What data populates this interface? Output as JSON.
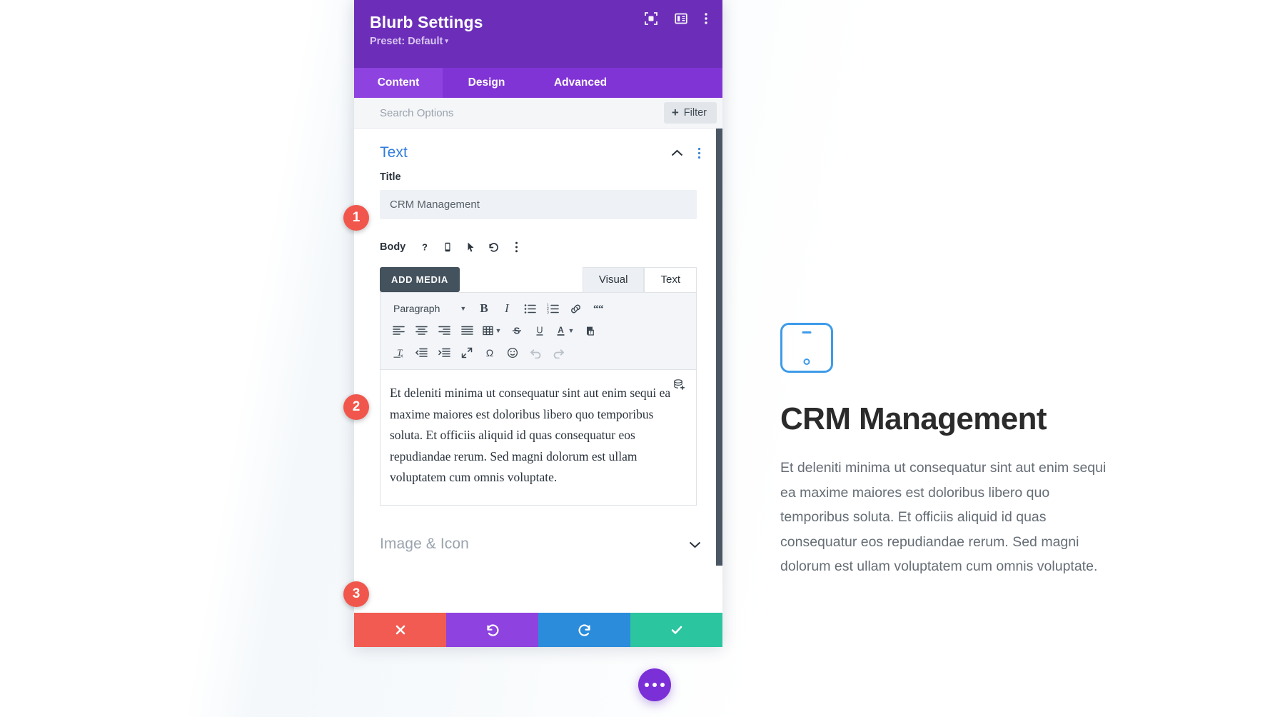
{
  "panel": {
    "title": "Blurb Settings",
    "preset": "Preset: Default",
    "preset_caret": "▾",
    "header_icons": [
      {
        "name": "expand-icon"
      },
      {
        "name": "layout-columns-icon"
      },
      {
        "name": "kebab-menu-icon"
      }
    ],
    "tabs": [
      {
        "label": "Content",
        "active": true
      },
      {
        "label": "Design",
        "active": false
      },
      {
        "label": "Advanced",
        "active": false
      }
    ],
    "search": {
      "placeholder": "Search Options",
      "value": ""
    },
    "filter": {
      "label": "Filter",
      "plus": "+"
    }
  },
  "sections": {
    "text": {
      "title": "Text",
      "collapse_icon": "chevron-up-icon",
      "menu_icon": "kebab-menu-icon"
    },
    "image_icon": {
      "title": "Image & Icon",
      "expand_icon": "chevron-down-icon"
    }
  },
  "fields": {
    "title": {
      "label": "Title",
      "value": "CRM Management"
    },
    "body": {
      "label": "Body",
      "icons": [
        "help-icon",
        "mobile-icon",
        "cursor-icon",
        "reset-icon",
        "kebab-menu-icon"
      ]
    }
  },
  "editor": {
    "add_media_label": "ADD MEDIA",
    "mode_tabs": [
      {
        "label": "Visual",
        "active": true
      },
      {
        "label": "Text",
        "active": false
      }
    ],
    "format_select": "Paragraph",
    "toolbar_row1": [
      "bold-icon",
      "italic-icon",
      "bulleted-list-icon",
      "numbered-list-icon",
      "link-icon",
      "blockquote-icon"
    ],
    "toolbar_row2": [
      "align-left-icon",
      "align-center-icon",
      "align-right-icon",
      "align-justify-icon",
      "table-icon",
      "strikethrough-icon",
      "underline-icon",
      "text-color-icon",
      "paste-as-text-icon"
    ],
    "toolbar_row3": [
      "clear-formatting-icon",
      "outdent-icon",
      "indent-icon",
      "fullscreen-icon",
      "special-character-icon",
      "emoji-icon",
      "undo-icon",
      "redo-icon"
    ],
    "dynamic_content_icon": "add-dynamic-content-icon",
    "content": "Et deleniti minima ut consequatur sint aut enim sequi ea maxime maiores est doloribus libero quo temporibus soluta. Et officiis aliquid id quas consequatur eos repudiandae rerum. Sed magni dolorum est ullam voluptatem cum omnis voluptate."
  },
  "bottom_bar": [
    {
      "name": "cancel-button",
      "icon": "close-icon",
      "color": "#F15B51"
    },
    {
      "name": "undo-button",
      "icon": "undo-icon",
      "color": "#8E42E0"
    },
    {
      "name": "redo-button",
      "icon": "redo-icon",
      "color": "#2B8CDB"
    },
    {
      "name": "save-button",
      "icon": "check-icon",
      "color": "#2BC5A0"
    }
  ],
  "markers": [
    {
      "label": "1"
    },
    {
      "label": "2"
    },
    {
      "label": "3"
    }
  ],
  "preview": {
    "icon": "tablet-device-icon",
    "icon_color": "#3E9BE9",
    "title": "CRM Management",
    "body": "Et deleniti minima ut consequatur sint aut enim sequi ea maxime maiores est doloribus libero quo temporibus soluta. Et officiis aliquid id quas consequatur eos repudiandae rerum. Sed magni dolorum est ullam voluptatem cum omnis voluptate."
  },
  "fab": {
    "name": "more-options-fab",
    "icon": "three-dots-icon"
  },
  "colors": {
    "header_purple": "#6C2EB9",
    "tabs_purple": "#8134D6",
    "active_tab_purple": "#8E42E0",
    "accent_blue": "#2f7ddd",
    "marker_red": "#F1564C"
  }
}
